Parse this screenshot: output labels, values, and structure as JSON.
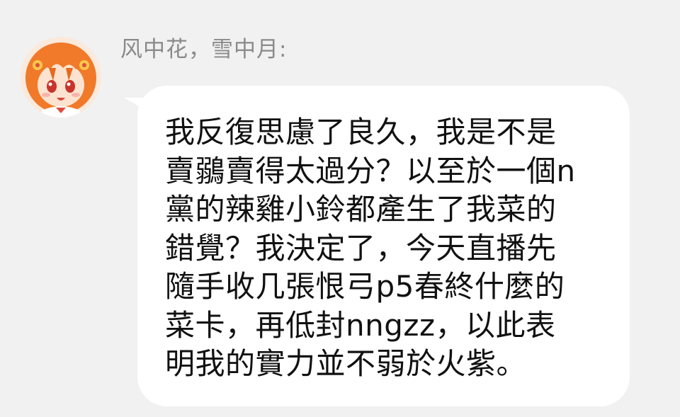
{
  "chat": {
    "sender_name": "风中花，雪中月:",
    "avatar": {
      "icon": "anime-girl-avatar-icon",
      "hair_color": "#f07a2a",
      "skin_color": "#fde3cf"
    },
    "message": {
      "lines": [
        "我反復思慮了良久，我是不是",
        "賣鶸賣得太過分？以至於一個n",
        "黨的辣雞小鈴都產生了我菜的",
        "錯覺？我決定了，今天直播先",
        "隨手收几張恨弓p5春終什麼的",
        "菜卡，再低封nngzz，以此表",
        "明我的實力並不弱於火紫。"
      ]
    }
  },
  "colors": {
    "background": "#f1f1f1",
    "bubble": "#ffffff",
    "sender_text": "#8a8a8a",
    "message_text": "#111111"
  }
}
